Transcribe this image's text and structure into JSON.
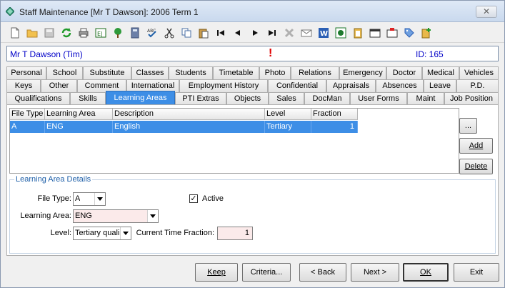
{
  "window": {
    "title": "Staff Maintenance  [Mr T Dawson]: 2006 Term 1",
    "close_glyph": "✕"
  },
  "toolbar": {
    "icons": [
      "new-document-icon",
      "open-folder-icon",
      "save-icon",
      "refresh-icon",
      "print-icon",
      "edit-icon",
      "tree-icon",
      "calculator-icon",
      "spellcheck-icon",
      "cut-icon",
      "copy-icon",
      "paste-icon",
      "first-record-icon",
      "previous-record-icon",
      "next-record-icon",
      "last-record-icon",
      "delete-icon",
      "email-icon",
      "word-icon",
      "excel-icon",
      "clipboard-icon",
      "calendar-icon",
      "schedule-icon",
      "tag-icon",
      "add-note-icon"
    ]
  },
  "header": {
    "name": "Mr T Dawson (Tim)",
    "alert": "!",
    "id_text": "ID: 165"
  },
  "tabs": {
    "row1": [
      "Personal",
      "School",
      "Substitute",
      "Classes",
      "Students",
      "Timetable",
      "Photo",
      "Relations",
      "Emergency",
      "Doctor",
      "Medical",
      "Vehicles"
    ],
    "row2": [
      "Keys",
      "Other",
      "Comment",
      "International",
      "Employment History",
      "Confidential",
      "Appraisals",
      "Absences",
      "Leave",
      "P.D."
    ],
    "row3": [
      "Qualifications",
      "Skills",
      "Learning Areas",
      "PTI Extras",
      "Objects",
      "Sales",
      "DocMan",
      "User Forms",
      "Maint",
      "Job Position"
    ],
    "active": "Learning Areas"
  },
  "grid": {
    "columns": [
      "File Type",
      "Learning Area",
      "Description",
      "Level",
      "Fraction"
    ],
    "rows": [
      {
        "file_type": "A",
        "learning_area": "ENG",
        "description": "English",
        "level": "Tertiary",
        "fraction": "1"
      }
    ]
  },
  "side_buttons": {
    "more": "...",
    "add": "Add",
    "delete": "Delete"
  },
  "details": {
    "title": "Learning Area Details",
    "file_type_label": "File Type:",
    "file_type_value": "A",
    "active_label": "Active",
    "active_checked": "✓",
    "learning_area_label": "Learning Area:",
    "learning_area_value": "ENG",
    "level_label": "Level:",
    "level_value": "Tertiary quali",
    "fraction_label": "Current Time Fraction:",
    "fraction_value": "1"
  },
  "footer": {
    "keep": "Keep",
    "criteria": "Criteria...",
    "back": "< Back",
    "next": "Next >",
    "ok": "OK",
    "exit": "Exit"
  }
}
